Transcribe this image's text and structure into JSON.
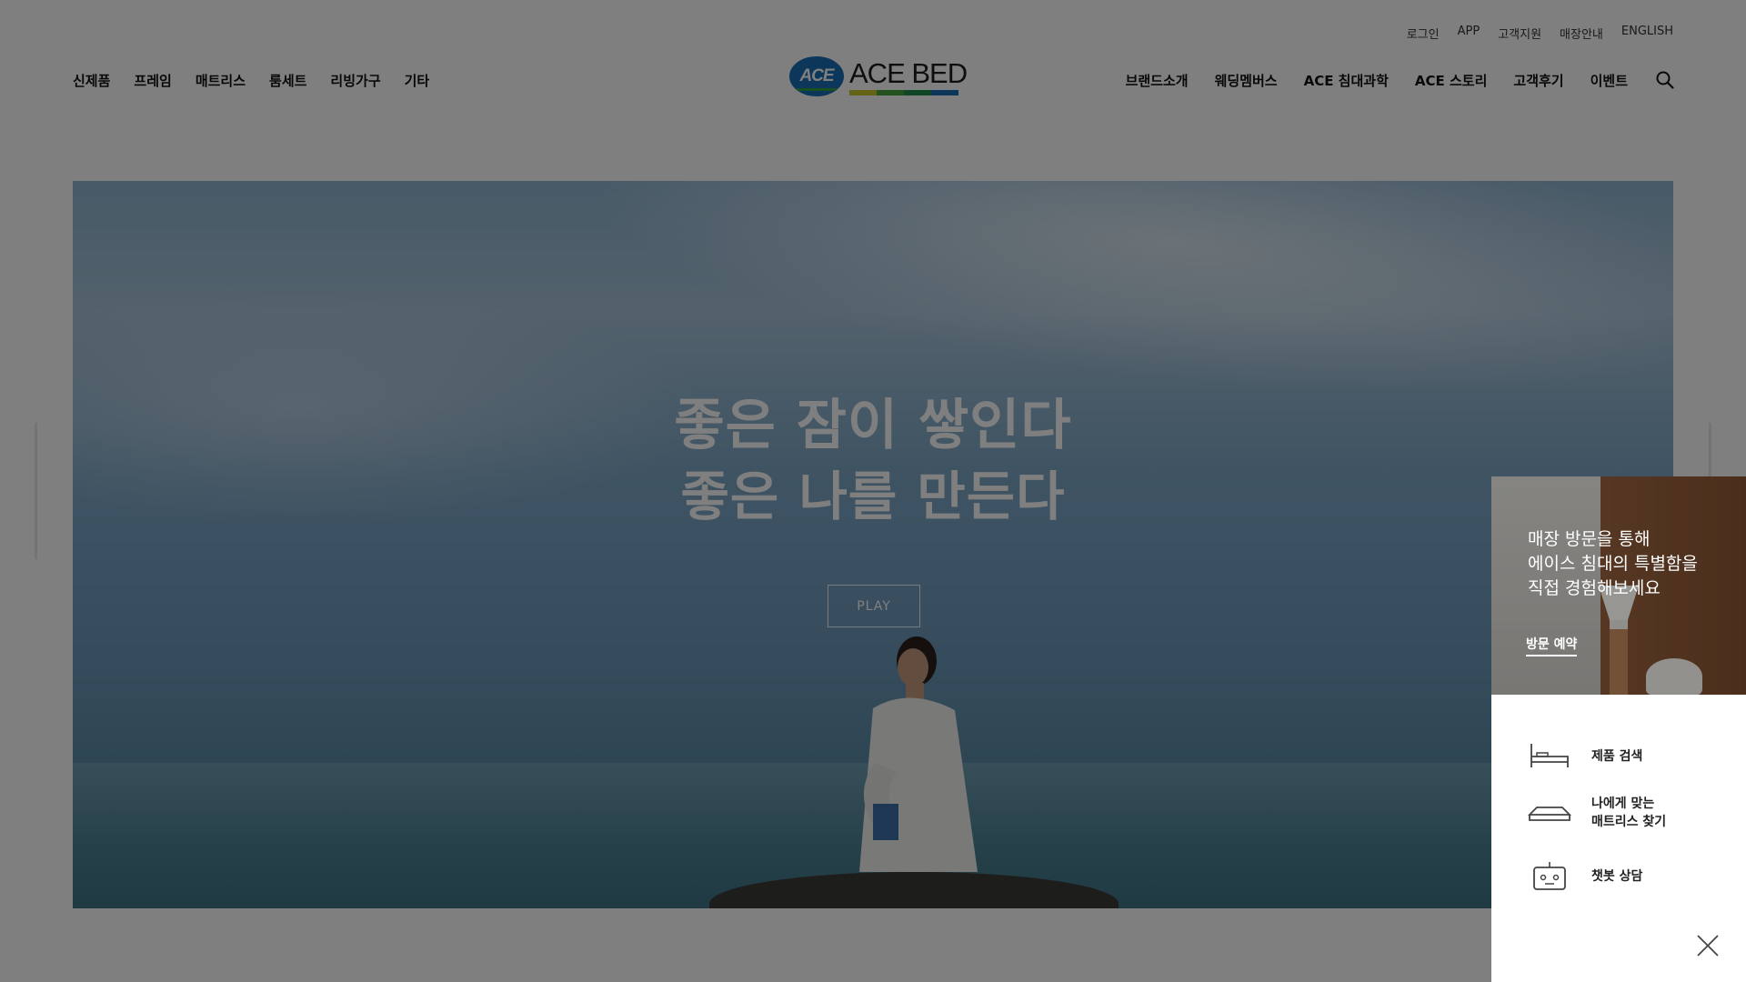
{
  "util_nav": [
    "로그인",
    "APP",
    "고객지원",
    "매장안내",
    "ENGLISH"
  ],
  "gnb_left": [
    "신제품",
    "프레임",
    "매트리스",
    "룸세트",
    "리빙가구",
    "기타"
  ],
  "gnb_right": [
    "브랜드소개",
    "웨딩멤버스",
    "ACE 침대과학",
    "ACE 스토리",
    "고객후기",
    "이벤트"
  ],
  "logo": {
    "badge": "ACE",
    "wordmark": "ACE BED",
    "bar_colors": [
      "#c9c42a",
      "#49a43c",
      "#1e8c4a",
      "#1a6fb5"
    ]
  },
  "hero": {
    "title": "좋은 잠이 쌓인다",
    "subtitle": "좋은 나를 만든다",
    "play_label": "PLAY"
  },
  "quick": {
    "banner_lines": [
      "매장 방문을 통해",
      "에이스 침대의 특별함을",
      "직접 경험해보세요"
    ],
    "banner_button": "방문 예약",
    "items": [
      {
        "label_lines": [
          "제품 검색"
        ],
        "icon": "bed-icon"
      },
      {
        "label_lines": [
          "나에게 맞는",
          "매트리스 찾기"
        ],
        "icon": "mattress-icon"
      },
      {
        "label_lines": [
          "챗봇 상담"
        ],
        "icon": "chatbot-icon"
      }
    ]
  },
  "colors": {
    "overlay": "rgba(0,0,0,0.5)",
    "brand_blue": "#1a6fb5"
  }
}
